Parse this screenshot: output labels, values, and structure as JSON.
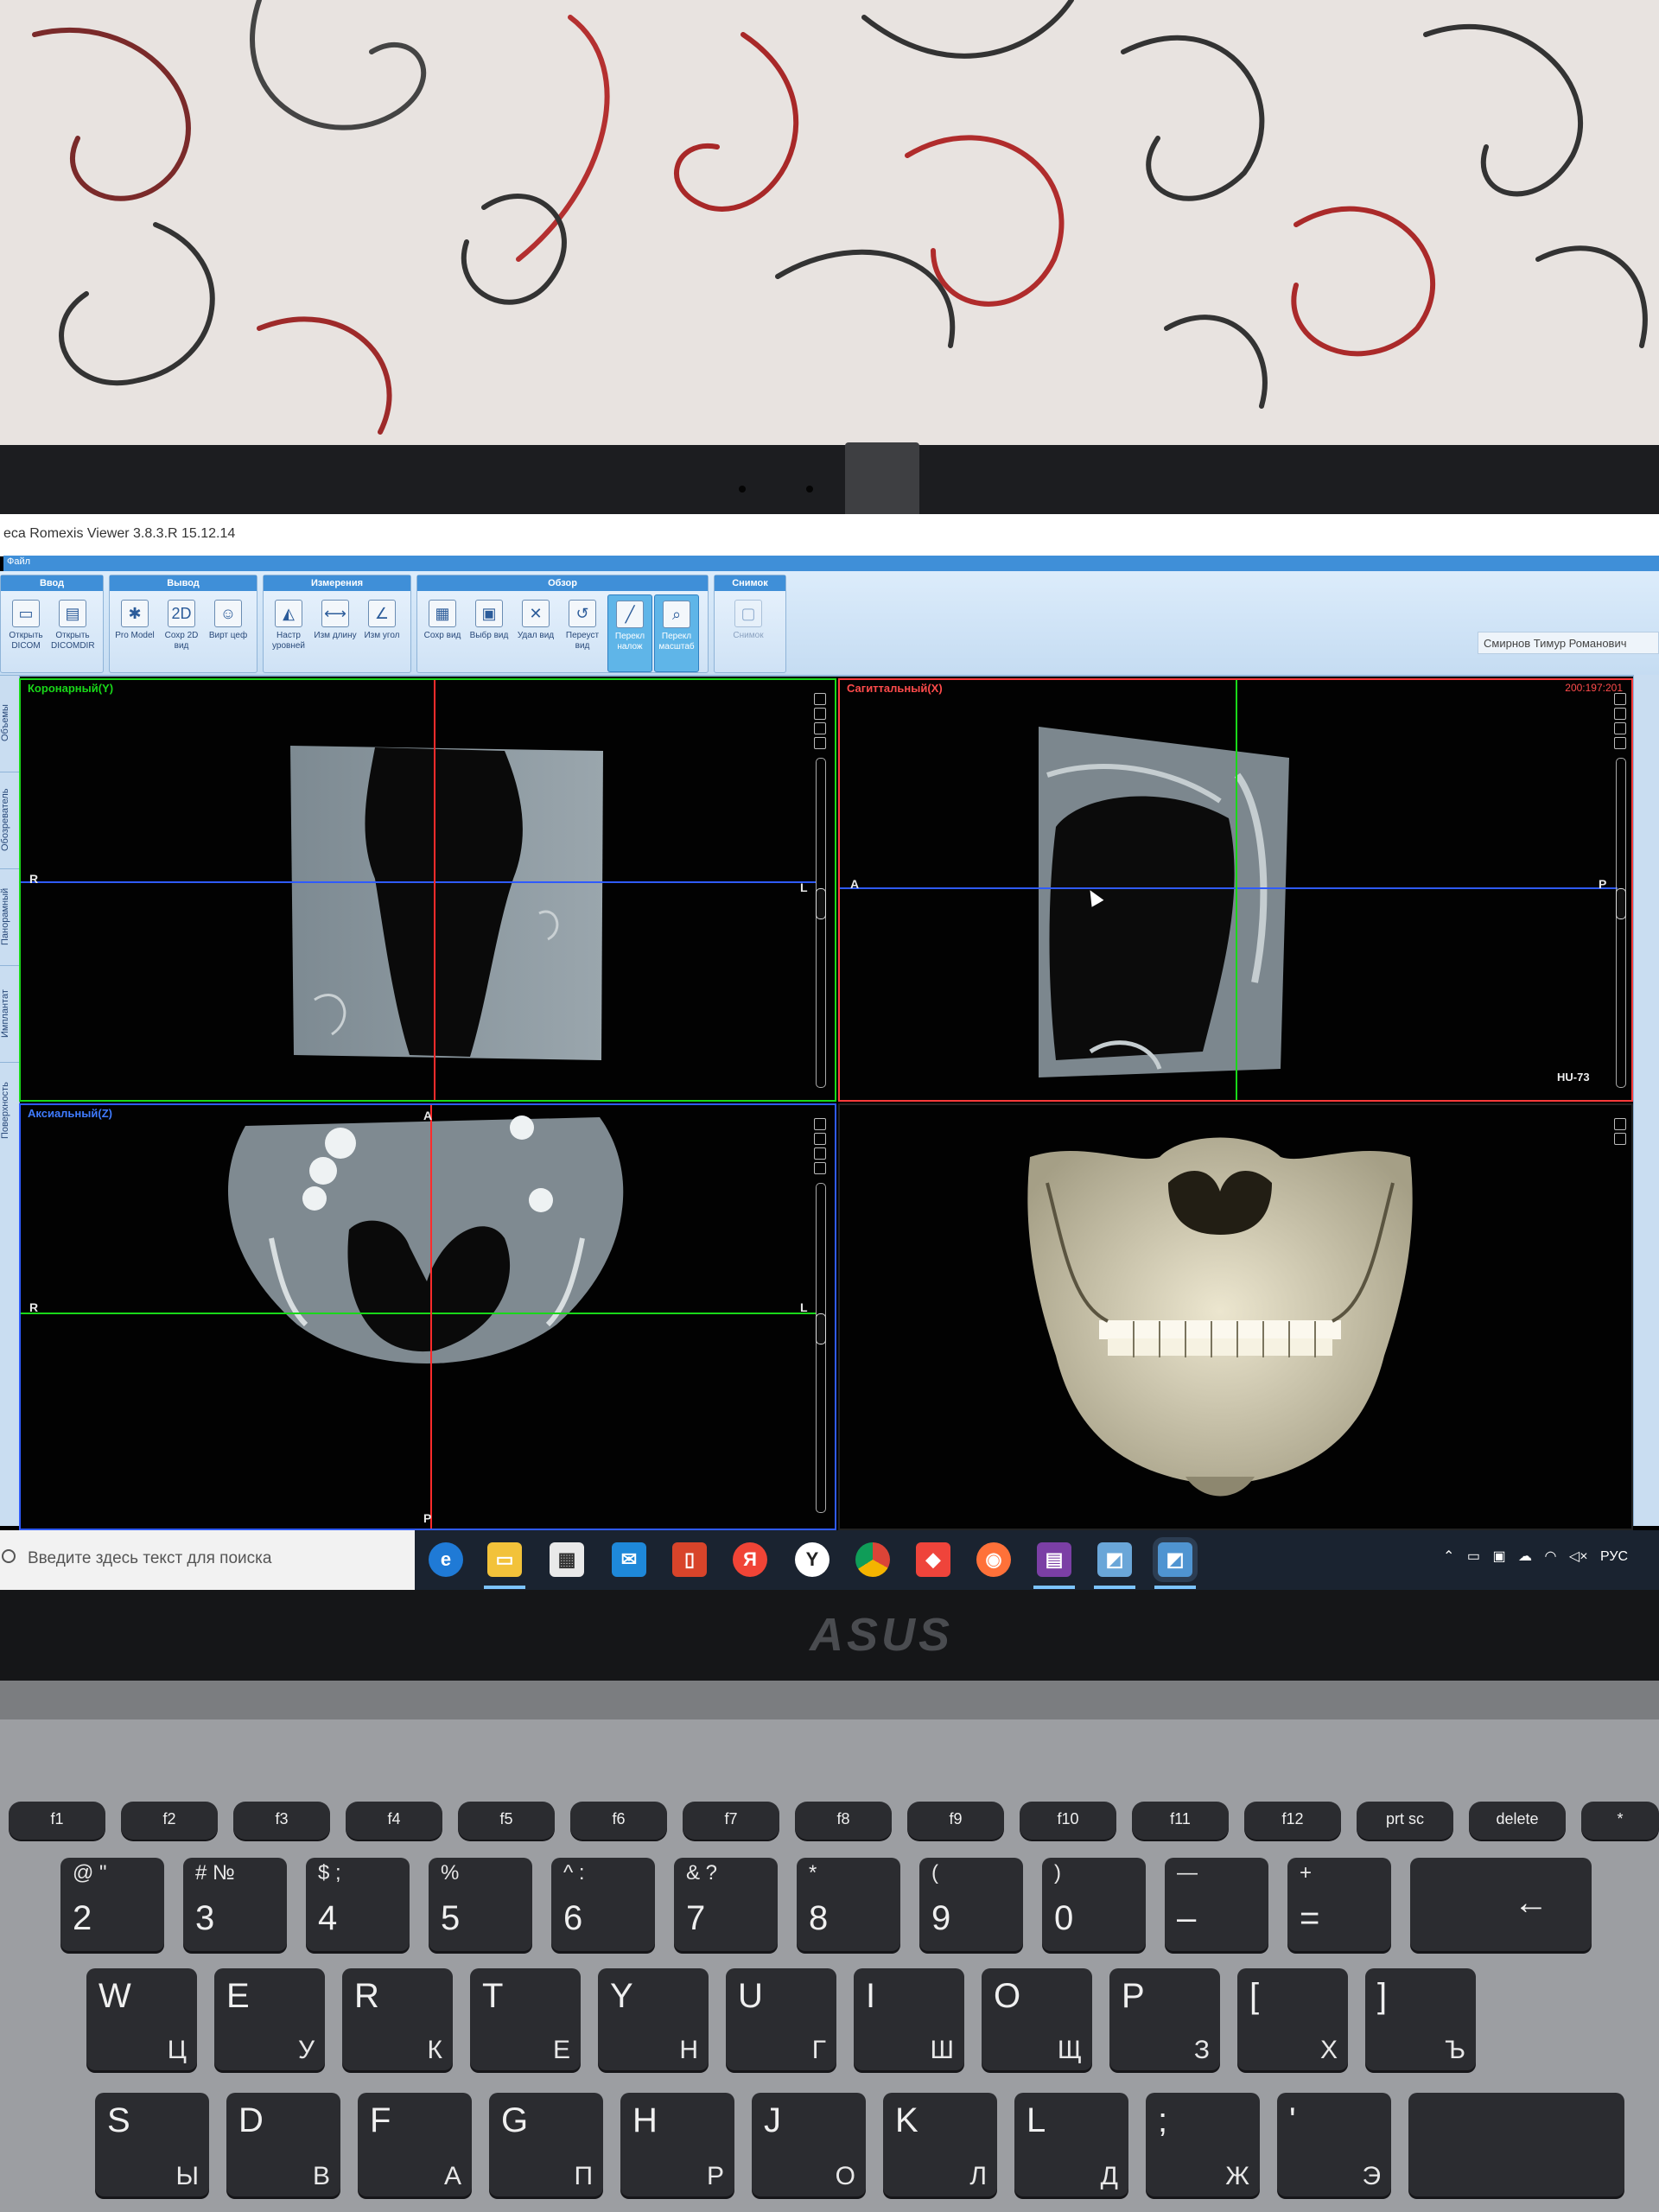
{
  "window": {
    "title": "eca Romexis Viewer 3.8.3.R  15.12.14",
    "file_menu": "Файл",
    "user": "Смирнов Тимур Романович"
  },
  "ribbon": {
    "groups": [
      {
        "title": "Ввод",
        "buttons": [
          {
            "label": "Открыть DICOM",
            "icon": "folder-icon"
          },
          {
            "label": "Открыть DICOMDIR",
            "icon": "dicomdir-icon"
          }
        ]
      },
      {
        "title": "Вывод",
        "buttons": [
          {
            "label": "Pro Model",
            "icon": "promodel-icon"
          },
          {
            "label": "Сохр 2D вид",
            "icon": "save-2d-icon"
          },
          {
            "label": "Вирт цеф",
            "icon": "virtual-ceph-icon"
          }
        ]
      },
      {
        "title": "Измерения",
        "buttons": [
          {
            "label": "Настр уровней",
            "icon": "levels-icon"
          },
          {
            "label": "Изм длину",
            "icon": "measure-length-icon"
          },
          {
            "label": "Изм угол",
            "icon": "measure-angle-icon"
          }
        ]
      },
      {
        "title": "Обзор",
        "buttons": [
          {
            "label": "Сохр вид",
            "icon": "save-view-icon"
          },
          {
            "label": "Выбр вид",
            "icon": "select-view-icon"
          },
          {
            "label": "Удал вид",
            "icon": "delete-view-icon"
          },
          {
            "label": "Переуст вид",
            "icon": "reset-view-icon"
          },
          {
            "label": "Перекл налож",
            "icon": "toggle-overlay-icon"
          },
          {
            "label": "Перекл масштаб",
            "icon": "toggle-scale-icon"
          }
        ]
      },
      {
        "title": "Снимок",
        "buttons": [
          {
            "label": "Снимок",
            "icon": "snapshot-icon"
          }
        ]
      }
    ]
  },
  "left_tabs": [
    "Объемы",
    "Обозреватель",
    "Панорамный",
    "Имплантат",
    "Поверхность"
  ],
  "viewports": {
    "coronal": {
      "title": "Коронарный(Y)",
      "left_label": "R",
      "right_label": "L"
    },
    "sagittal": {
      "title": "Сагиттальный(X)",
      "coords": "200:197:201",
      "hu": "HU-73",
      "left_label": "A",
      "right_label": "P"
    },
    "axial": {
      "title": "Аксиальный(Z)",
      "top_label": "A",
      "bottom_label": "P",
      "left_label": "R",
      "right_label": "L"
    },
    "render3d": {
      "title": ""
    }
  },
  "taskbar": {
    "search_placeholder": "Введите здесь текст для поиска",
    "apps": [
      "edge-icon",
      "file-explorer-icon",
      "store-icon",
      "mail-icon",
      "office-icon",
      "yandex-icon",
      "yandex-browser-icon",
      "chrome-icon",
      "anydesk-icon",
      "firefox-icon",
      "winrar-icon",
      "romexis-icon",
      "romexis-viewer-icon"
    ],
    "yandex_letter": "Я",
    "language": "РУС"
  },
  "laptop": {
    "brand": "ASUS"
  },
  "keyboard": {
    "fkeys": [
      "f1",
      "f2",
      "f3",
      "f4",
      "f5",
      "f6",
      "f7",
      "f8",
      "f9",
      "f10",
      "f11",
      "f12",
      "prt sc",
      "delete",
      "*"
    ],
    "row1": [
      {
        "main": "2",
        "top": "@  \""
      },
      {
        "main": "3",
        "top": "#  №"
      },
      {
        "main": "4",
        "top": "$  ;"
      },
      {
        "main": "5",
        "top": "%"
      },
      {
        "main": "6",
        "top": "^  :"
      },
      {
        "main": "7",
        "top": "&  ?"
      },
      {
        "main": "8",
        "top": "*"
      },
      {
        "main": "9",
        "top": "("
      },
      {
        "main": "0",
        "top": ")"
      },
      {
        "main": "–",
        "top": "—"
      },
      {
        "main": "=",
        "top": "+"
      }
    ],
    "row2": [
      {
        "main": "W",
        "alt": "Ц"
      },
      {
        "main": "E",
        "alt": "У"
      },
      {
        "main": "R",
        "alt": "К"
      },
      {
        "main": "T",
        "alt": "Е"
      },
      {
        "main": "Y",
        "alt": "Н"
      },
      {
        "main": "U",
        "alt": "Г"
      },
      {
        "main": "I",
        "alt": "Ш"
      },
      {
        "main": "O",
        "alt": "Щ"
      },
      {
        "main": "P",
        "alt": "З"
      },
      {
        "main": "[",
        "alt": "Х"
      },
      {
        "main": "]",
        "alt": "Ъ"
      }
    ],
    "row3": [
      {
        "main": "S",
        "alt": "Ы"
      },
      {
        "main": "D",
        "alt": "В"
      },
      {
        "main": "F",
        "alt": "А"
      },
      {
        "main": "G",
        "alt": "П"
      },
      {
        "main": "H",
        "alt": "Р"
      },
      {
        "main": "J",
        "alt": "О"
      },
      {
        "main": "K",
        "alt": "Л"
      },
      {
        "main": "L",
        "alt": "Д"
      },
      {
        "main": ";",
        "alt": "Ж"
      },
      {
        "main": "'",
        "alt": "Э"
      }
    ]
  },
  "colors": {
    "coronal_accent": "#19d819",
    "sagittal_accent": "#ff3b3b",
    "axial_accent": "#2f5bff",
    "ribbon_accent": "#3f8fd8"
  }
}
